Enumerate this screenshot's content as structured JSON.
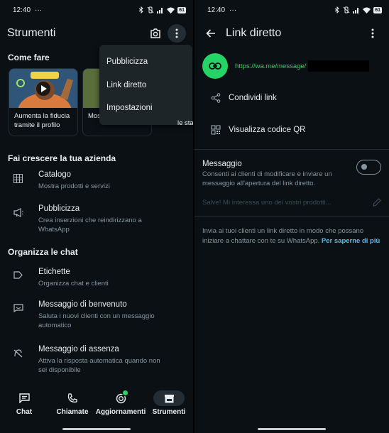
{
  "colors": {
    "background": "#0b1014",
    "accent_green": "#25d366",
    "link_blue": "#53bdeb",
    "divider": "#222d34",
    "secondary_text": "#8696a0"
  },
  "left": {
    "status": {
      "time": "12:40",
      "dots": "···",
      "battery": "61"
    },
    "appbar": {
      "title": "Strumenti",
      "camera_icon": "camera-icon",
      "more_icon": "more-vert-icon"
    },
    "menu": {
      "items": [
        "Pubblicizza",
        "Link diretto",
        "Impostazioni"
      ]
    },
    "how_to": {
      "header": "Come fare",
      "cards": [
        {
          "label": "Aumenta la fiducia tramite il profilo"
        },
        {
          "label": "Mos"
        },
        {
          "label": "le stato"
        }
      ]
    },
    "grow": {
      "header": "Fai crescere la tua azienda",
      "items": [
        {
          "icon": "catalog-grid-icon",
          "name": "Catalogo",
          "desc": "Mostra prodotti e servizi"
        },
        {
          "icon": "megaphone-icon",
          "name": "Pubblicizza",
          "desc": "Crea inserzioni che reindirizzano a WhatsApp"
        }
      ]
    },
    "organize": {
      "header": "Organizza le chat",
      "items": [
        {
          "icon": "label-icon",
          "name": "Etichette",
          "desc": "Organizza chat e clienti"
        },
        {
          "icon": "greeting-message-icon",
          "name": "Messaggio di benvenuto",
          "desc": "Saluta i nuovi clienti con un messaggio automatico"
        },
        {
          "icon": "away-message-icon",
          "name": "Messaggio di assenza",
          "desc": "Attiva la risposta automatica quando non sei disponibile"
        }
      ]
    },
    "nav": {
      "items": [
        {
          "label": "Chat",
          "icon": "chat-icon"
        },
        {
          "label": "Chiamate",
          "icon": "phone-icon"
        },
        {
          "label": "Aggiornamenti",
          "icon": "updates-icon"
        },
        {
          "label": "Strumenti",
          "icon": "store-icon"
        }
      ],
      "active": "Strumenti"
    }
  },
  "right": {
    "status": {
      "time": "12:40",
      "dots": "···",
      "battery": "61"
    },
    "appbar": {
      "title": "Link diretto",
      "back_icon": "back-arrow-icon",
      "more_icon": "more-vert-icon"
    },
    "link": {
      "url": "https://wa.me/message/",
      "icon": "link-icon"
    },
    "actions": [
      {
        "icon": "share-icon",
        "label": "Condividi link"
      },
      {
        "icon": "qr-code-icon",
        "label": "Visualizza codice QR"
      }
    ],
    "message": {
      "title": "Messaggio",
      "desc": "Consenti ai clienti di modificare e inviare un messaggio all'apertura del link diretto.",
      "toggle_on": false,
      "placeholder": "Salve! Mi interessa uno dei vostri prodotti...",
      "edit_icon": "pencil-icon"
    },
    "info": {
      "text": "Invia ai tuoi clienti un link diretto in modo che possano iniziare a chattare con te su WhatsApp.",
      "link": "Per saperne di più"
    }
  }
}
